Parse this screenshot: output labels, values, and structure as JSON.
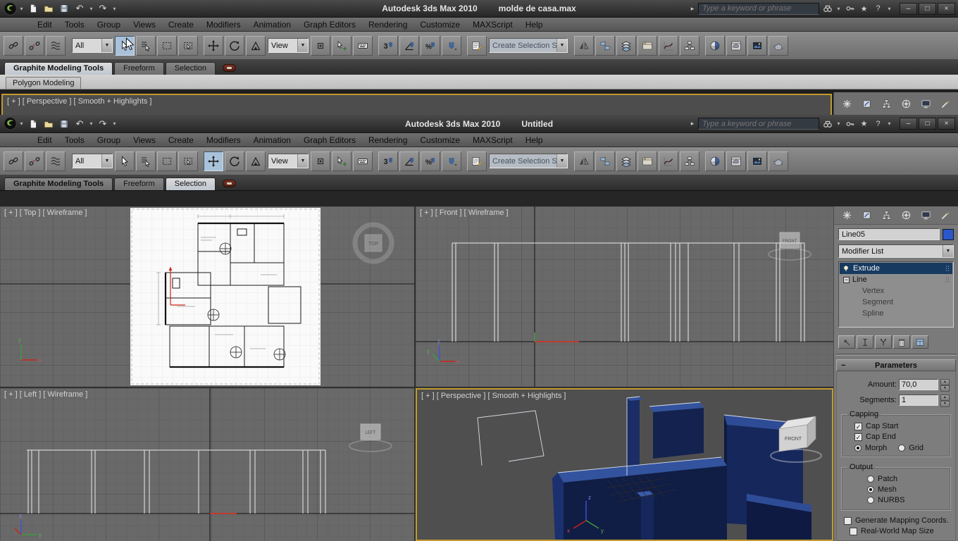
{
  "app": {
    "product": "Autodesk 3ds Max  2010",
    "search_placeholder": "Type a keyword or phrase"
  },
  "windows": {
    "w1": {
      "file": "molde de casa.max",
      "viewport_label": "[ + ] [ Perspective ] [ Smooth + Highlights ]"
    },
    "w2": {
      "file": "Untitled"
    }
  },
  "menu": [
    "Edit",
    "Tools",
    "Group",
    "Views",
    "Create",
    "Modifiers",
    "Animation",
    "Graph Editors",
    "Rendering",
    "Customize",
    "MAXScript",
    "Help"
  ],
  "toolbar": {
    "filter_value": "All",
    "coord_system_value": "View",
    "named_selection_placeholder": "Create Selection Se"
  },
  "ribbon": {
    "tabs": [
      "Graphite Modeling Tools",
      "Freeform",
      "Selection"
    ],
    "panel_tab": "Polygon Modeling"
  },
  "viewports": {
    "top_label": "[ + ] [ Top ] [ Wireframe ]",
    "front_label": "[ + ] [ Front ] [ Wireframe ]",
    "left_label": "[ + ] [ Left ] [ Wireframe ]",
    "persp_label": "[ + ] [ Perspective ] [ Smooth + Highlights ]",
    "viewcube_top": "TOP",
    "viewcube_front": "FRONT",
    "viewcube_left": "LEFT",
    "axis_x": "x",
    "axis_y": "y",
    "axis_z": "z"
  },
  "command_panel": {
    "object_name": "Line05",
    "object_color": "#2a57cc",
    "modifier_list": "Modifier List",
    "stack": {
      "modifier": "Extrude",
      "base": "Line",
      "sub_levels": [
        "Vertex",
        "Segment",
        "Spline"
      ]
    },
    "parameters": {
      "title": "Parameters",
      "amount_label": "Amount:",
      "amount_value": "70,0",
      "segments_label": "Segments:",
      "segments_value": "1",
      "capping_title": "Capping",
      "cap_start_label": "Cap Start",
      "cap_end_label": "Cap End",
      "morph_label": "Morph",
      "grid_label": "Grid",
      "output_title": "Output",
      "patch_label": "Patch",
      "mesh_label": "Mesh",
      "nurbs_label": "NURBS",
      "gen_mapping_label": "Generate Mapping Coords.",
      "real_world_label": "Real-World Map Size"
    }
  },
  "colors": {
    "active_viewport_border": "#c19b2e",
    "selected_stack_row": "#173a60",
    "extrude_fill": "#1a2d66"
  },
  "icons": {
    "check": "✓",
    "dropdown_arrow": "▼",
    "spin_up": "▲",
    "spin_down": "▼",
    "collapse": "−",
    "minimize": "–",
    "maximize": "□",
    "close": "×",
    "undo": "↶",
    "redo": "↷",
    "star": "★",
    "help": "?",
    "search_arrow": "▸",
    "app_menu_arrow": "▾"
  }
}
